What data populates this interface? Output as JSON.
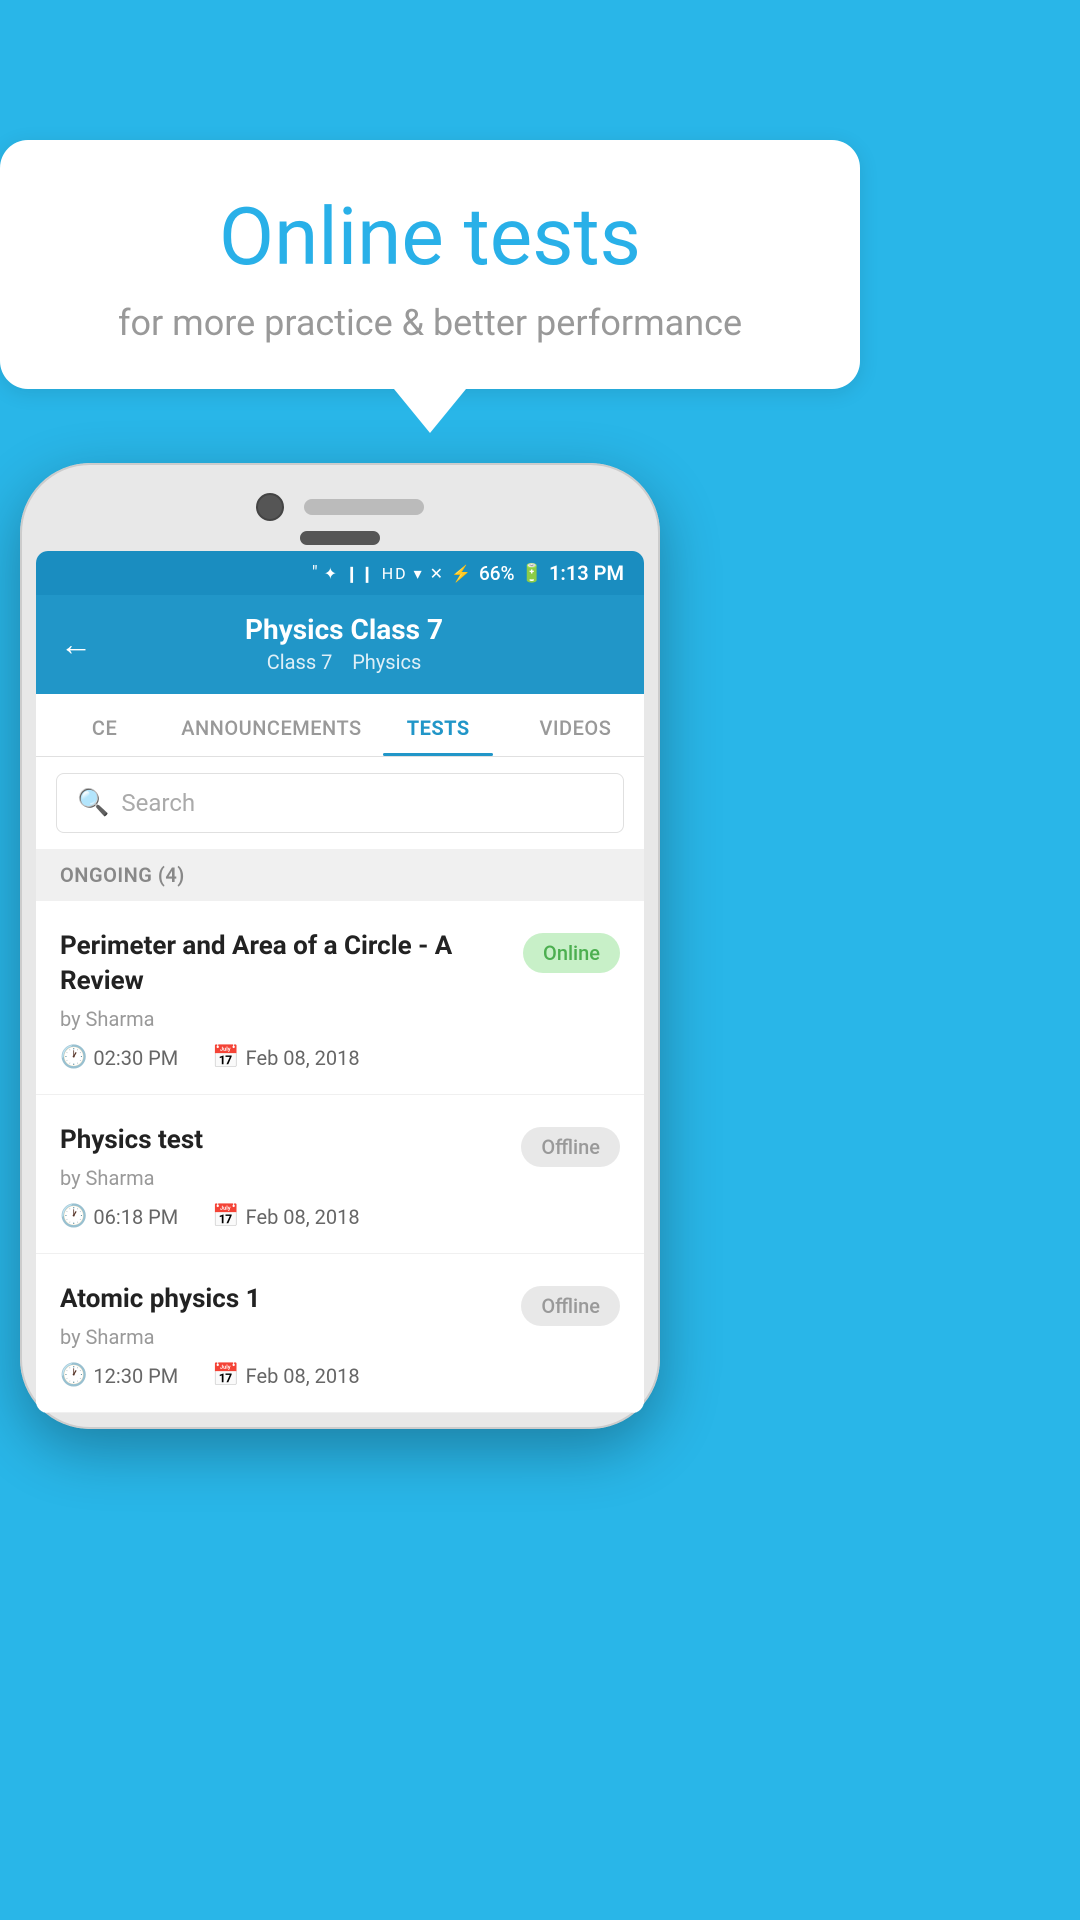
{
  "background": {
    "color": "#29b6e8"
  },
  "hero": {
    "title": "Online tests",
    "subtitle": "for more practice & better performance"
  },
  "statusBar": {
    "time": "1:13 PM",
    "battery": "66%",
    "icons": "bluetooth vibrate hd wifi signal x"
  },
  "appHeader": {
    "title": "Physics Class 7",
    "subtitle_part1": "Class 7",
    "subtitle_separator": "  ",
    "subtitle_part2": "Physics",
    "back_label": "←"
  },
  "tabs": [
    {
      "label": "CE",
      "active": false
    },
    {
      "label": "ANNOUNCEMENTS",
      "active": false
    },
    {
      "label": "TESTS",
      "active": true
    },
    {
      "label": "VIDEOS",
      "active": false
    }
  ],
  "search": {
    "placeholder": "Search"
  },
  "sections": [
    {
      "header": "ONGOING (4)",
      "tests": [
        {
          "title": "Perimeter and Area of a Circle - A Review",
          "author": "by Sharma",
          "time": "02:30 PM",
          "date": "Feb 08, 2018",
          "status": "Online",
          "status_type": "online"
        },
        {
          "title": "Physics test",
          "author": "by Sharma",
          "time": "06:18 PM",
          "date": "Feb 08, 2018",
          "status": "Offline",
          "status_type": "offline"
        },
        {
          "title": "Atomic physics 1",
          "author": "by Sharma",
          "time": "12:30 PM",
          "date": "Feb 08, 2018",
          "status": "Offline",
          "status_type": "offline"
        }
      ]
    }
  ]
}
